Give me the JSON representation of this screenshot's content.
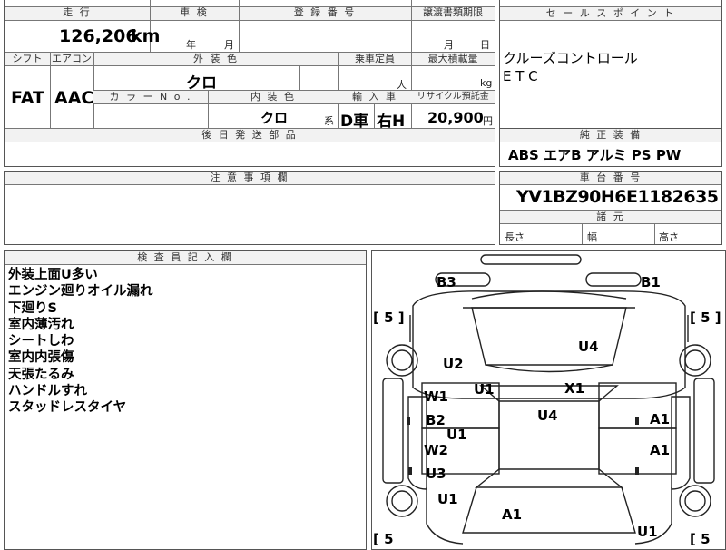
{
  "top": {
    "mileage_label": "走 行",
    "shaken_label": "車 検",
    "registration_label": "登 録 番 号",
    "transfer_docs_label": "譲渡書類期限",
    "selling_points_label": "セ ー ル ス ポ イ ン ト"
  },
  "mileage": {
    "value": "126,206",
    "unit": "km"
  },
  "shaken": {
    "year_unit": "年",
    "month_unit": "月"
  },
  "transfer": {
    "month_unit": "月",
    "day_unit": "日"
  },
  "row2": {
    "shift_label": "シフト",
    "aircon_label": "エアコン",
    "exterior_color_label": "外 装 色",
    "capacity_label": "乗車定員",
    "max_load_label": "最大積載量"
  },
  "shift": "FAT",
  "aircon": "AAC",
  "exterior_color": "クロ",
  "capacity_unit": "人",
  "max_load_unit": "kg",
  "row3": {
    "color_no_label": "カ ラ ー N o .",
    "interior_color_label": "内 装 色",
    "import_label": "輸 入 車",
    "recycle_label": "リサイクル預託金"
  },
  "interior_color": "クロ",
  "interior_suffix": "系",
  "import": {
    "dealer": "D車",
    "steering": "右H"
  },
  "recycle": {
    "value": "20,900",
    "unit": "円"
  },
  "later_parts_label": "後 日 発 送 部 品",
  "selling_points": [
    "クルーズコントロール",
    "E T C"
  ],
  "genuine_label": "純 正 装 備",
  "genuine_equipment": "ABS エアB アルミ PS PW",
  "notes_label": "注 意 事 項 欄",
  "chassis_label": "車 台 番 号",
  "chassis_number": "YV1BZ90H6E1182635",
  "dimensions": {
    "label": "諸 元",
    "length": "長さ",
    "width": "幅",
    "height": "高さ"
  },
  "inspector_label": "検 査 員 記 入 欄",
  "inspector_notes": [
    "外装上面U多い",
    "エンジン廻りオイル漏れ",
    "下廻りS",
    "室内薄汚れ",
    "シートしわ",
    "室内内張傷",
    "天張たるみ",
    "ハンドルすれ",
    "スタッドレスタイヤ"
  ],
  "diagram": {
    "tire_marks": [
      "[ 5 ]",
      "[ 5 ]",
      "[ 5",
      "[ 5"
    ],
    "codes": [
      "B3",
      "B1",
      "U4",
      "U2",
      "U1",
      "X1",
      "W1",
      "U4",
      "B2",
      "A1",
      "U1",
      "W2",
      "A1",
      "U3",
      "U1",
      "A1",
      "U1"
    ]
  }
}
